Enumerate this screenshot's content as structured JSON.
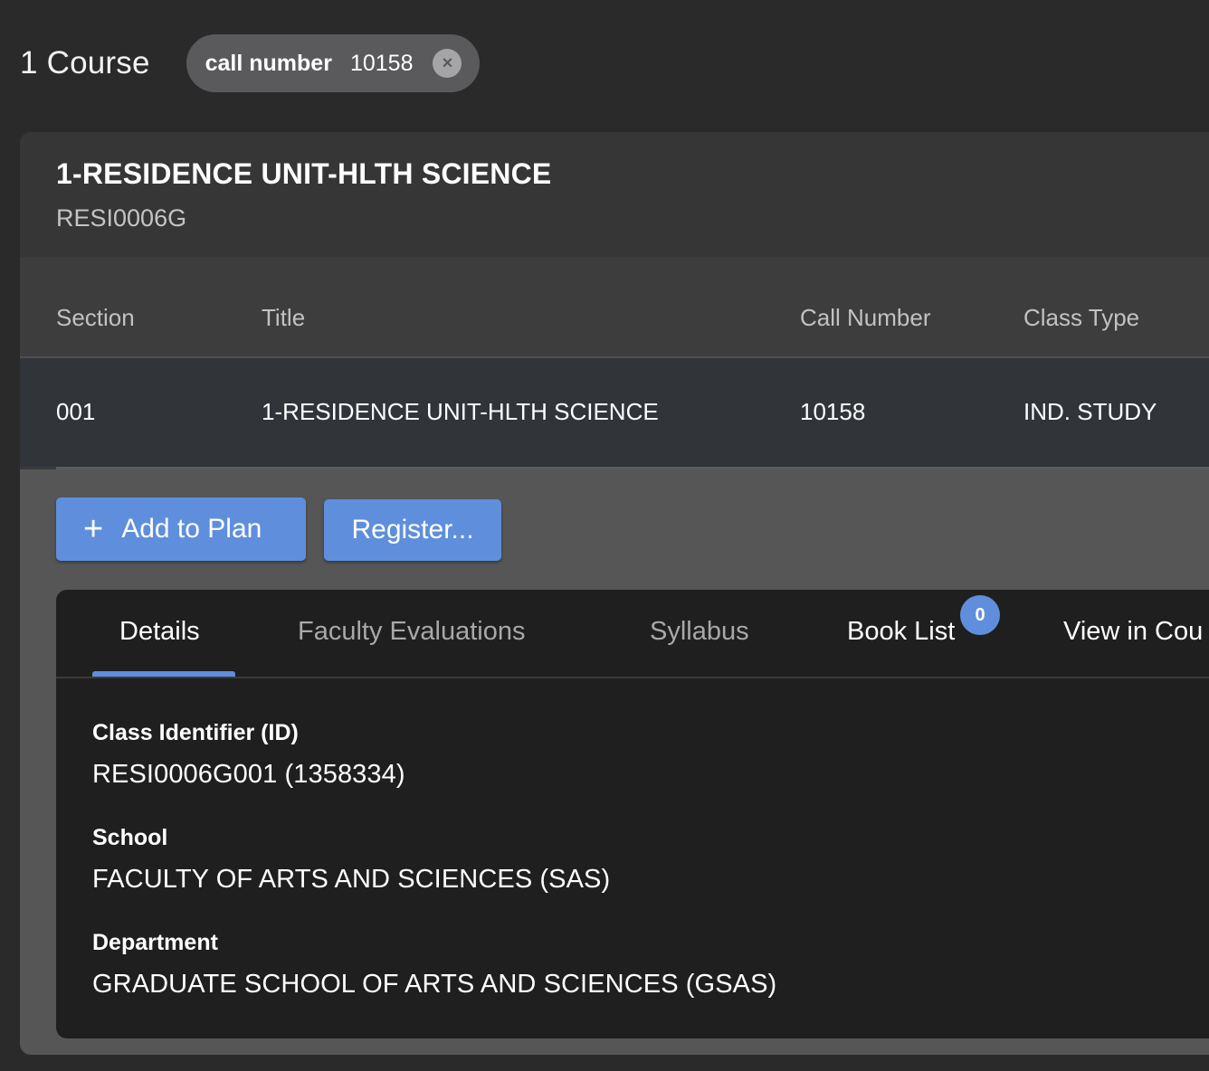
{
  "results": {
    "count_label": "1 Course"
  },
  "filter": {
    "key": "call number",
    "value": "10158",
    "remove_glyph": "×"
  },
  "course": {
    "title": "1-RESIDENCE UNIT-HLTH SCIENCE",
    "code": "RESI0006G"
  },
  "table": {
    "headers": [
      "Section",
      "Title",
      "Call Number",
      "Class Type"
    ],
    "rows": [
      [
        "001",
        "1-RESIDENCE UNIT-HLTH SCIENCE",
        "10158",
        "IND. STUDY"
      ]
    ]
  },
  "actions": {
    "add_icon": "+",
    "add_label": "Add to Plan",
    "register_label": "Register..."
  },
  "tabs": {
    "items": [
      "Details",
      "Faculty Evaluations",
      "Syllabus",
      "Book List",
      "View in Cou"
    ],
    "active": "Details",
    "book_list_count": "0"
  },
  "details": {
    "fields": [
      {
        "label": "Class Identifier (ID)",
        "value": "RESI0006G001 (1358334)"
      },
      {
        "label": "School",
        "value": "FACULTY OF ARTS AND SCIENCES (SAS)"
      },
      {
        "label": "Department",
        "value": "GRADUATE SCHOOL OF ARTS AND SCIENCES (GSAS)"
      }
    ]
  },
  "colors": {
    "background": "#2a2a2b",
    "accent": "#5f8fdc",
    "panel": "#1f1f1f"
  }
}
